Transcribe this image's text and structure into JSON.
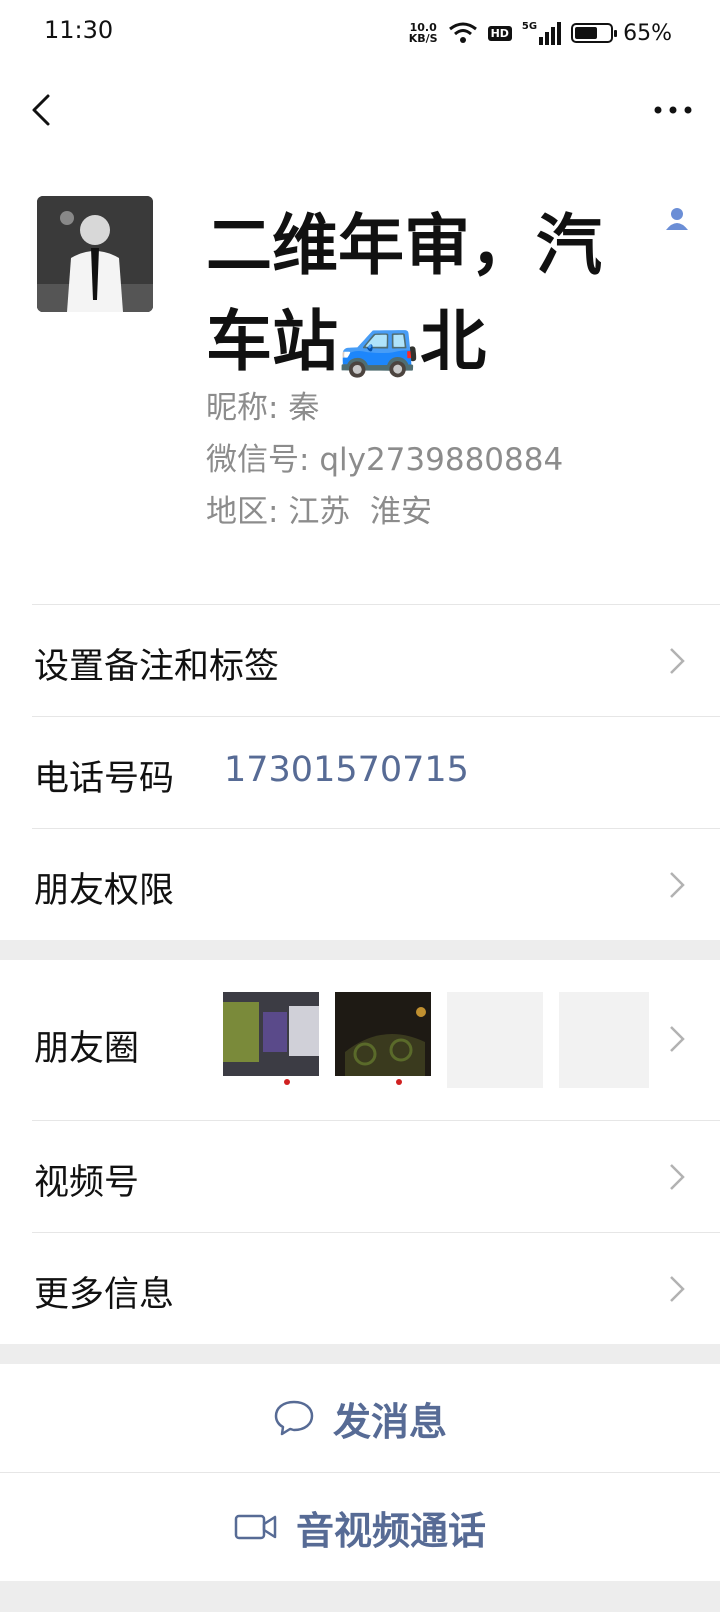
{
  "status_bar": {
    "time": "11:30",
    "net_speed_value": "10.0",
    "net_speed_unit": "KB/S",
    "hd_badge": "HD",
    "signal_label": "5G",
    "battery_percent": "65%",
    "battery_level": 0.65
  },
  "profile": {
    "display_name": "二维年审，汽车站🚙北",
    "nickname_label": "昵称:",
    "nickname": "秦",
    "wechat_id_label": "微信号:",
    "wechat_id": "qly2739880884",
    "region_label": "地区:",
    "region": "江苏  淮安"
  },
  "rows": {
    "remarks": "设置备注和标签",
    "phone_label": "电话号码",
    "phone_value": "17301570715",
    "friend_permissions": "朋友权限",
    "moments": "朋友圈",
    "channels": "视频号",
    "more_info": "更多信息"
  },
  "actions": {
    "message": "发消息",
    "call": "音视频通话"
  },
  "colors": {
    "link": "#576b95",
    "muted": "#8c8c8c",
    "background": "#ededed"
  }
}
